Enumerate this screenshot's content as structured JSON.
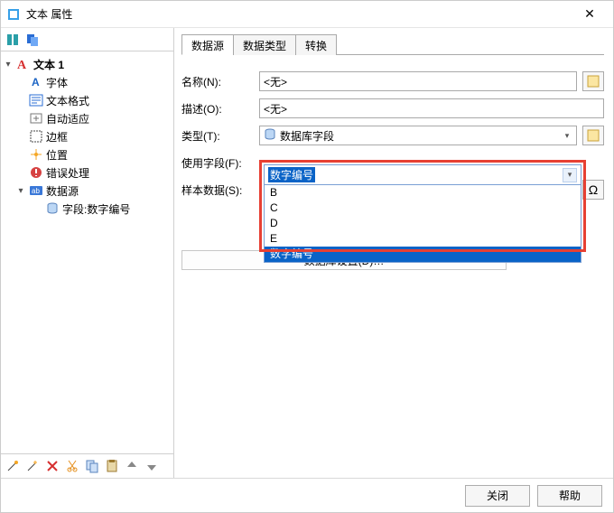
{
  "window": {
    "title": "文本 属性"
  },
  "tree": {
    "root": "文本 1",
    "items": [
      {
        "label": "字体"
      },
      {
        "label": "文本格式"
      },
      {
        "label": "自动适应"
      },
      {
        "label": "边框"
      },
      {
        "label": "位置"
      },
      {
        "label": "错误处理"
      },
      {
        "label": "数据源",
        "expanded": true,
        "children": [
          {
            "label": "字段:数字编号"
          }
        ]
      }
    ]
  },
  "tabs": {
    "items": [
      "数据源",
      "数据类型",
      "转换"
    ],
    "active": 0
  },
  "form": {
    "name": {
      "label": "名称(N):",
      "value": "<无>"
    },
    "desc": {
      "label": "描述(O):",
      "value": "<无>"
    },
    "type": {
      "label": "类型(T):",
      "value": "数据库字段"
    },
    "field": {
      "label": "使用字段(F):",
      "value": "数字编号",
      "options": [
        "B",
        "C",
        "D",
        "E",
        "数字编号"
      ]
    },
    "sample": {
      "label": "样本数据(S):",
      "value": ""
    },
    "dbSettings": "数据库设置(D)…"
  },
  "footer": {
    "close": "关闭",
    "help": "帮助"
  }
}
